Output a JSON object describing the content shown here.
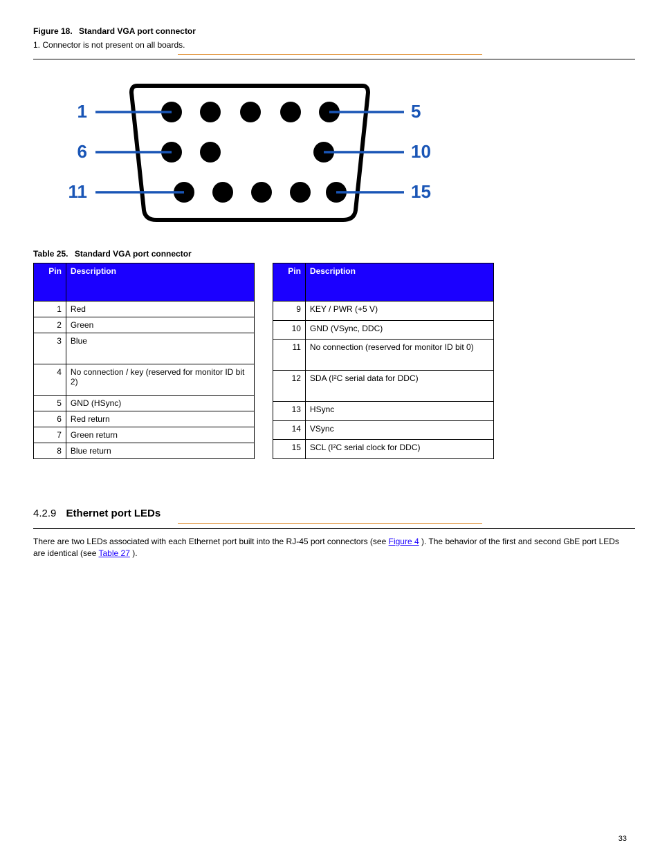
{
  "fig18": {
    "number": "Figure 18.",
    "label": "Standard VGA port connector",
    "note_prefix": "1.",
    "note": "Connector is not present on all boards."
  },
  "connector": {
    "labels": {
      "l1": "1",
      "l2": "6",
      "l3": "11",
      "r1": "5",
      "r2": "10",
      "r3": "15"
    }
  },
  "tab25": {
    "number": "Table 25.",
    "label": "Standard VGA port connector"
  },
  "headers": {
    "pin": "Pin",
    "desc": "Description"
  },
  "pins_left": [
    {
      "pin": "1",
      "desc": "Red"
    },
    {
      "pin": "2",
      "desc": "Green"
    },
    {
      "pin": "3",
      "desc": "Blue",
      "tall": true
    },
    {
      "pin": "4",
      "desc": "No connection / key (reserved for monitor ID bit 2)",
      "tall": true
    },
    {
      "pin": "5",
      "desc": "GND (HSync)"
    },
    {
      "pin": "6",
      "desc": "Red return"
    },
    {
      "pin": "7",
      "desc": "Green return"
    },
    {
      "pin": "8",
      "desc": "Blue return"
    }
  ],
  "pins_right": [
    {
      "pin": "9",
      "desc": "KEY / PWR (+5 V)"
    },
    {
      "pin": "10",
      "desc": "GND (VSync, DDC)"
    },
    {
      "pin": "11",
      "desc": "No connection (reserved for monitor ID bit 0)",
      "tall": true
    },
    {
      "pin": "12",
      "desc": "SDA (I²C serial data for DDC)",
      "tall": true
    },
    {
      "pin": "13",
      "desc": "HSync"
    },
    {
      "pin": "14",
      "desc": "VSync"
    },
    {
      "pin": "15",
      "desc": "SCL (I²C serial clock for DDC)"
    }
  ],
  "sec": {
    "num": "4.2.9",
    "title": "Ethernet port LEDs"
  },
  "body": {
    "p1_a": "There are two LEDs associated with each Ethernet port built into the RJ-45 port connectors (see ",
    "p1_link": "Figure 4",
    "p1_b": "). The behavior of the first and second GbE port LEDs are identical (see ",
    "p1_link2": "Table 27",
    "p1_c": ")."
  },
  "page": "33"
}
